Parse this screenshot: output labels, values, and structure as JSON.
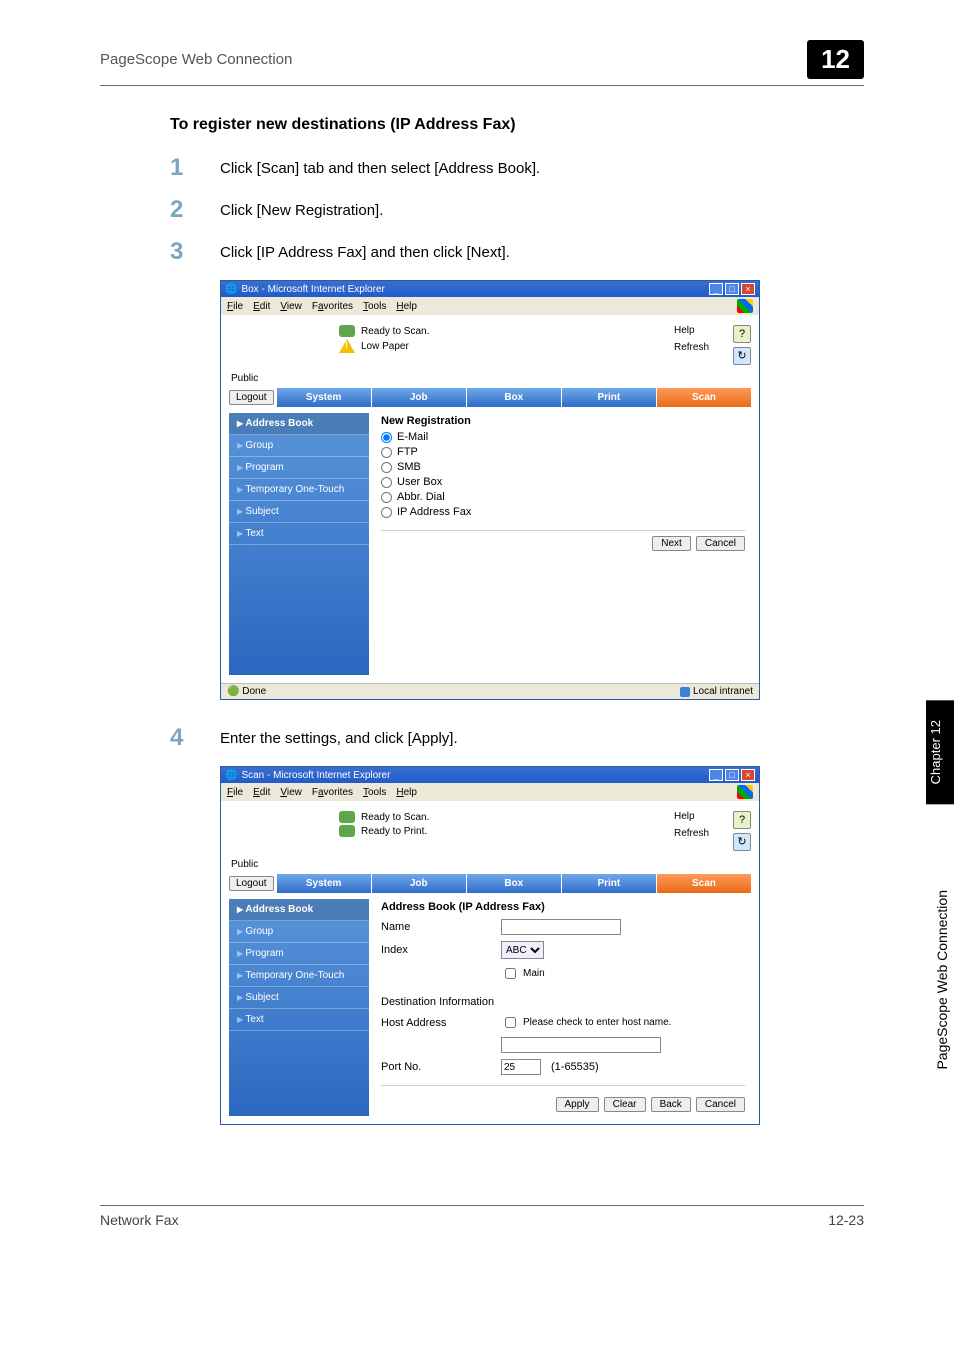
{
  "header": {
    "title": "PageScope Web Connection",
    "chapter": "12"
  },
  "section_heading": "To register new destinations (IP Address Fax)",
  "steps": {
    "s1": "Click [Scan] tab and then select [Address Book].",
    "s2": "Click [New Registration].",
    "s3": "Click [IP Address Fax] and then click [Next].",
    "s4": "Enter the settings, and click [Apply]."
  },
  "ie1": {
    "title": "Box - Microsoft Internet Explorer",
    "menubar": {
      "file": "File",
      "edit": "Edit",
      "view": "View",
      "fav": "Favorites",
      "tools": "Tools",
      "help": "Help"
    },
    "status_ready": "Ready to Scan.",
    "status_warn": "Low Paper",
    "help_label": "Help",
    "refresh_label": "Refresh",
    "public_label": "Public",
    "logout": "Logout",
    "tabs": {
      "system": "System",
      "job": "Job",
      "box": "Box",
      "print": "Print",
      "scan": "Scan"
    },
    "side": {
      "address": "Address Book",
      "group": "Group",
      "program": "Program",
      "tot": "Temporary One-Touch",
      "subject": "Subject",
      "text": "Text"
    },
    "content": {
      "title": "New Registration",
      "opts": {
        "email": "E-Mail",
        "ftp": "FTP",
        "smb": "SMB",
        "userbox": "User Box",
        "abbr": "Abbr. Dial",
        "ipfax": "IP Address Fax"
      },
      "next": "Next",
      "cancel": "Cancel"
    },
    "statusbar": {
      "done": "Done",
      "intranet": "Local intranet"
    }
  },
  "ie2": {
    "title": "Scan - Microsoft Internet Explorer",
    "status_ready": "Ready to Scan.",
    "status_print": "Ready to Print.",
    "help_label": "Help",
    "refresh_label": "Refresh",
    "public_label": "Public",
    "logout": "Logout",
    "tabs": {
      "system": "System",
      "job": "Job",
      "box": "Box",
      "print": "Print",
      "scan": "Scan"
    },
    "side": {
      "address": "Address Book",
      "group": "Group",
      "program": "Program",
      "tot": "Temporary One-Touch",
      "subject": "Subject",
      "text": "Text"
    },
    "content": {
      "title": "Address Book (IP Address Fax)",
      "name_label": "Name",
      "index_label": "Index",
      "index_value": "ABC",
      "main_chk": "Main",
      "dest_title": "Destination Information",
      "host_label": "Host Address",
      "host_chk": "Please check to enter host name.",
      "port_label": "Port No.",
      "port_value": "25",
      "port_range": "(1-65535)",
      "apply": "Apply",
      "clear": "Clear",
      "back": "Back",
      "cancel": "Cancel"
    }
  },
  "side_tab": "Chapter 12",
  "side_text": "PageScope Web Connection",
  "footer": {
    "left": "Network Fax",
    "right": "12-23"
  }
}
